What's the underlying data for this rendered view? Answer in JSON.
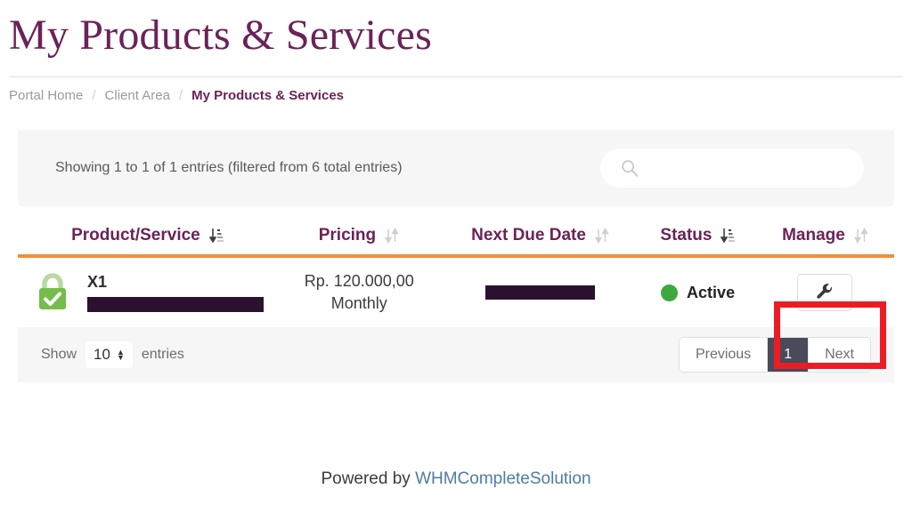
{
  "header": {
    "title": "My Products & Services"
  },
  "breadcrumb": {
    "items": [
      {
        "label": "Portal Home",
        "active": false
      },
      {
        "label": "Client Area",
        "active": false
      },
      {
        "label": "My Products & Services",
        "active": true
      }
    ],
    "separator": "/"
  },
  "filter_panel": {
    "entries_info": "Showing 1 to 1 of 1 entries (filtered from 6 total entries)",
    "search": {
      "value": "",
      "placeholder": "",
      "icon": "search-icon"
    }
  },
  "table": {
    "columns": [
      {
        "label": "Product/Service",
        "sort": "desc-active"
      },
      {
        "label": "Pricing",
        "sort": "none"
      },
      {
        "label": "Next Due Date",
        "sort": "none"
      },
      {
        "label": "Status",
        "sort": "desc-active"
      },
      {
        "label": "Manage",
        "sort": "none"
      }
    ],
    "rows": [
      {
        "ssl_icon": "green-lock-icon",
        "product_name": "X1",
        "domain_redacted": true,
        "price": "Rp. 120.000,00",
        "billing_cycle": "Monthly",
        "next_due_date_redacted": true,
        "status": "Active",
        "status_color": "#3da83d",
        "manage_icon": "wrench-icon"
      }
    ],
    "accent_color": "#ef8f3c",
    "header_color": "#6b2258"
  },
  "table_footer": {
    "show_label": "Show",
    "length_value": "10",
    "entries_label": "entries",
    "pagination": {
      "previous": "Previous",
      "pages": [
        "1"
      ],
      "next": "Next",
      "current": "1"
    }
  },
  "annotation": {
    "highlight_color": "#ec1c24",
    "target": "manage-button"
  },
  "footer": {
    "powered_prefix": "Powered by ",
    "powered_link": "WHMCompleteSolution"
  }
}
